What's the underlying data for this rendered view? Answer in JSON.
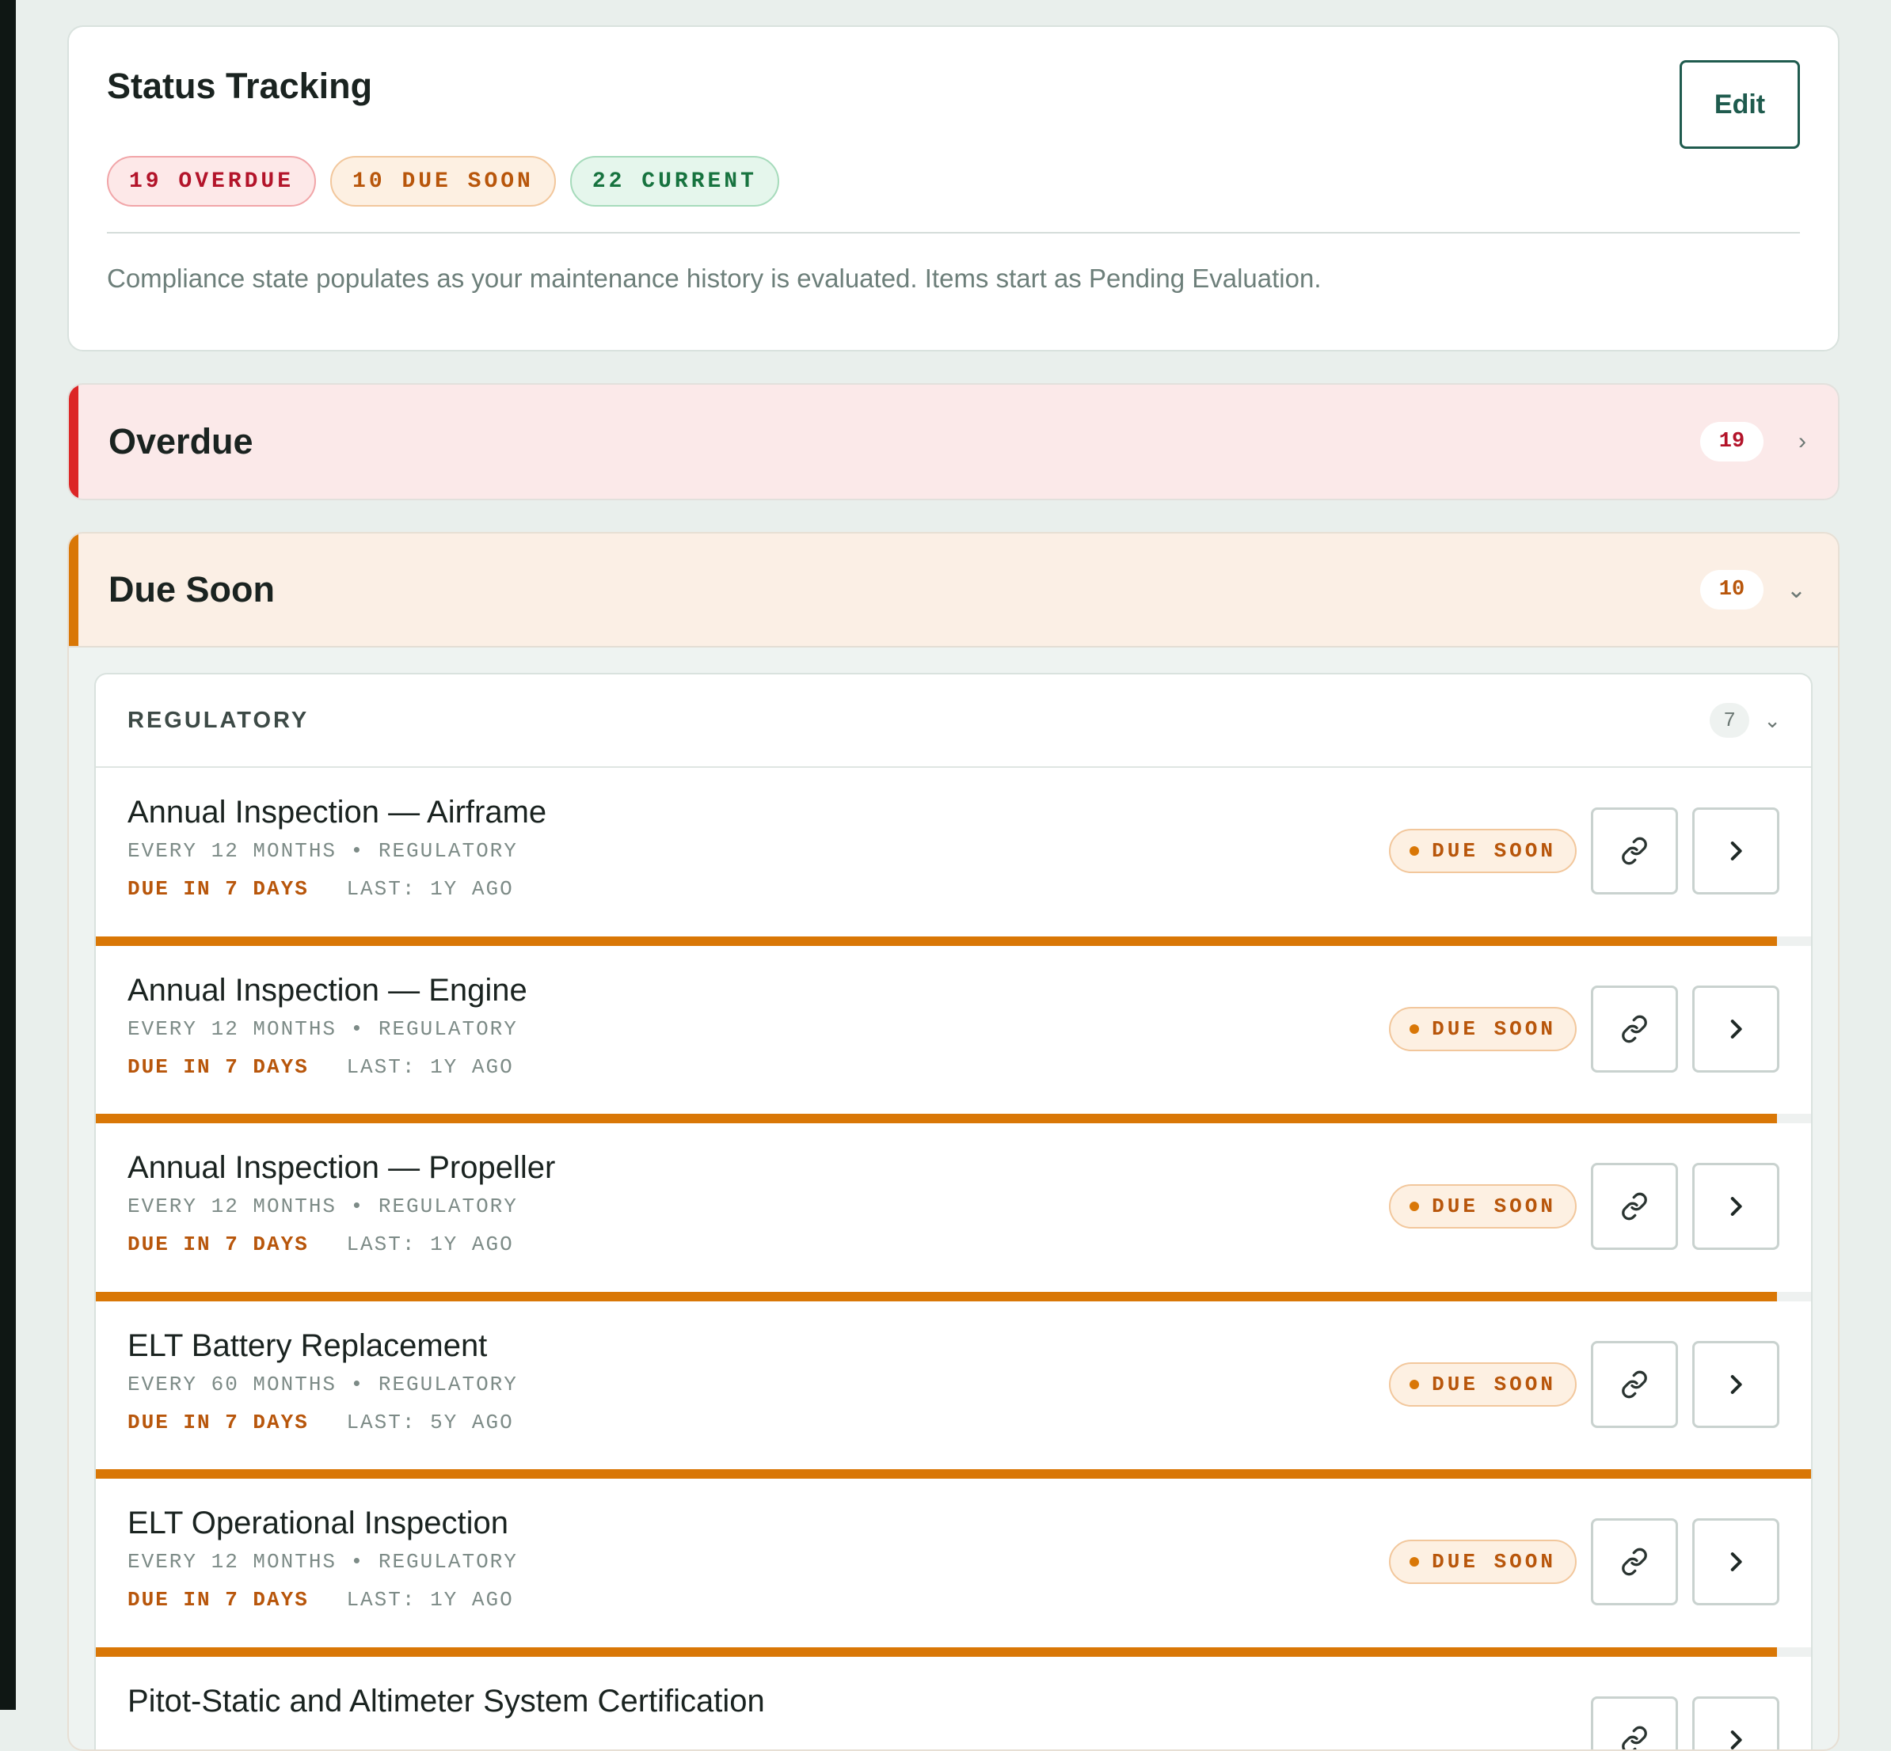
{
  "status": {
    "title": "Status Tracking",
    "edit_label": "Edit",
    "pills": {
      "overdue": "19 OVERDUE",
      "soon": "10 DUE SOON",
      "current": "22 CURRENT"
    },
    "description": "Compliance state populates as your maintenance history is evaluated. Items start as Pending Evaluation."
  },
  "sections": {
    "overdue": {
      "title": "Overdue",
      "count": "19",
      "chevron": "›"
    },
    "soon": {
      "title": "Due Soon",
      "count": "10",
      "chevron": "⌄"
    }
  },
  "subgroup": {
    "title": "REGULATORY",
    "count": "7",
    "chevron": "⌄"
  },
  "items": [
    {
      "title": "Annual Inspection — Airframe",
      "meta": "EVERY 12 MONTHS • REGULATORY",
      "due": "DUE IN 7 DAYS",
      "last": "LAST: 1Y AGO",
      "badge": "DUE SOON",
      "progress": 0.98
    },
    {
      "title": "Annual Inspection — Engine",
      "meta": "EVERY 12 MONTHS • REGULATORY",
      "due": "DUE IN 7 DAYS",
      "last": "LAST: 1Y AGO",
      "badge": "DUE SOON",
      "progress": 0.98
    },
    {
      "title": "Annual Inspection — Propeller",
      "meta": "EVERY 12 MONTHS • REGULATORY",
      "due": "DUE IN 7 DAYS",
      "last": "LAST: 1Y AGO",
      "badge": "DUE SOON",
      "progress": 0.98
    },
    {
      "title": "ELT Battery Replacement",
      "meta": "EVERY 60 MONTHS • REGULATORY",
      "due": "DUE IN 7 DAYS",
      "last": "LAST: 5Y AGO",
      "badge": "DUE SOON",
      "progress": 1.0
    },
    {
      "title": "ELT Operational Inspection",
      "meta": "EVERY 12 MONTHS • REGULATORY",
      "due": "DUE IN 7 DAYS",
      "last": "LAST: 1Y AGO",
      "badge": "DUE SOON",
      "progress": 0.98
    },
    {
      "title": "Pitot-Static and Altimeter System Certification",
      "meta": "",
      "due": "",
      "last": "",
      "badge": "",
      "progress": 0
    }
  ],
  "colors": {
    "accent": "#1f5b4e",
    "overdue": "#dc2626",
    "soon": "#d97706",
    "current": "#17733f"
  },
  "icons": {
    "link": "link-icon",
    "open": "chevron-right-icon"
  }
}
